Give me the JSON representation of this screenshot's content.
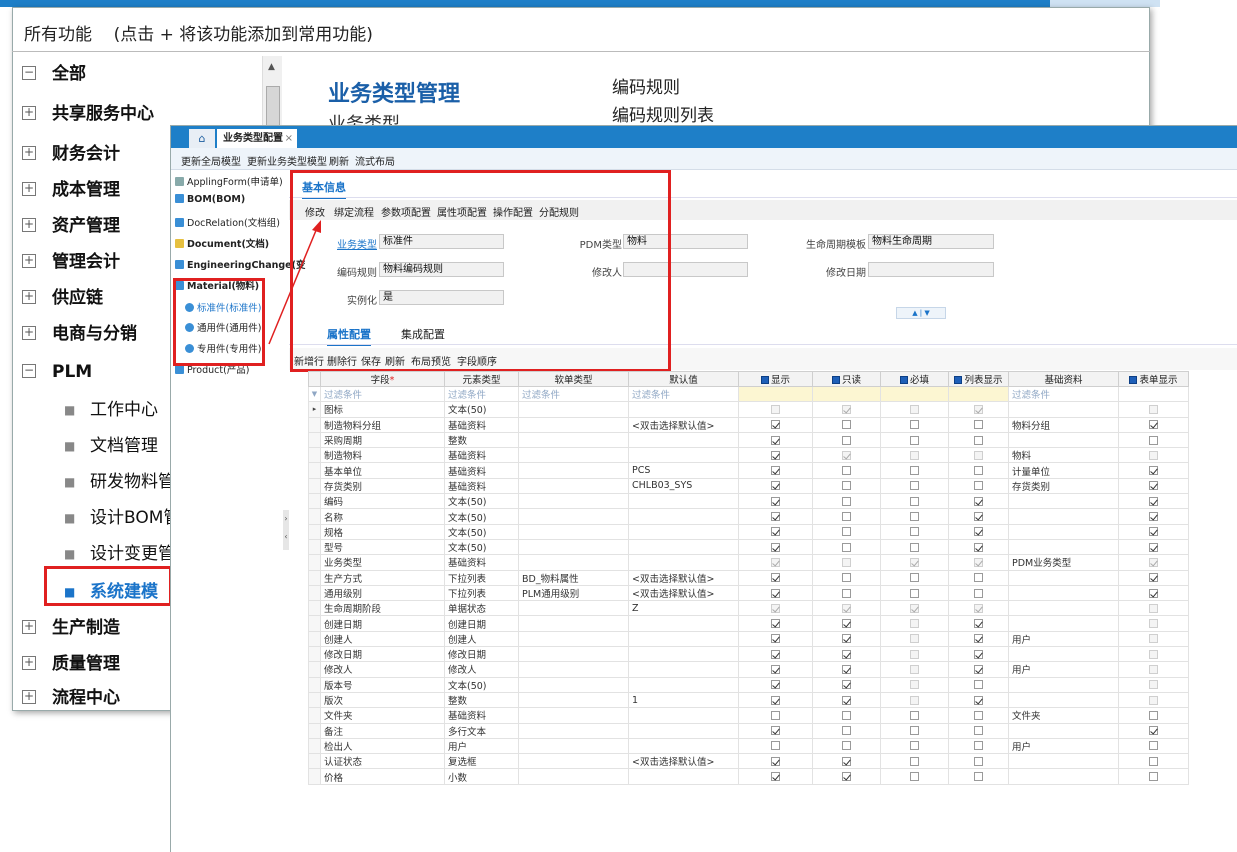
{
  "background_window": {
    "title": "所有功能    (点击 + 将该功能添加到常用功能)",
    "tree": [
      {
        "label": "全部",
        "box": "−",
        "type": "root"
      },
      {
        "label": "共享服务中心",
        "box": "+",
        "type": "node"
      },
      {
        "label": "财务会计",
        "box": "+",
        "type": "node"
      },
      {
        "label": "成本管理",
        "box": "+",
        "type": "node"
      },
      {
        "label": "资产管理",
        "box": "+",
        "type": "node"
      },
      {
        "label": "管理会计",
        "box": "+",
        "type": "node"
      },
      {
        "label": "供应链",
        "box": "+",
        "type": "node"
      },
      {
        "label": "电商与分销",
        "box": "+",
        "type": "node"
      },
      {
        "label": "PLM",
        "box": "−",
        "type": "node"
      },
      {
        "label": "工作中心",
        "type": "sub"
      },
      {
        "label": "文档管理",
        "type": "sub"
      },
      {
        "label": "研发物料管",
        "type": "sub"
      },
      {
        "label": "设计BOM管",
        "type": "sub"
      },
      {
        "label": "设计变更管",
        "type": "sub"
      },
      {
        "label": "系统建模",
        "type": "sub",
        "selected": true
      },
      {
        "label": "生产制造",
        "box": "+",
        "type": "node"
      },
      {
        "label": "质量管理",
        "box": "+",
        "type": "node"
      },
      {
        "label": "流程中心",
        "box": "+",
        "type": "node"
      }
    ],
    "right_title": "业务类型管理",
    "right_title2": "业务类型",
    "right_link1": "编码规则",
    "right_link2": "编码规则列表"
  },
  "front_window": {
    "home_icon": "home-icon",
    "active_tab": "业务类型配置",
    "close_glyph": "×",
    "toolbar": [
      "更新全局模型",
      "更新业务类型模型",
      "刷新",
      "流式布局"
    ],
    "left_nav": [
      {
        "label": "ApplingForm(申请单)",
        "icon": "form-icon",
        "bold": false
      },
      {
        "label": "BOM(BOM)",
        "icon": "bom-icon",
        "bold": true
      },
      {
        "label": "DocRelation(文档组)",
        "icon": "folder-icon",
        "bold": false
      },
      {
        "label": "Document(文档)",
        "icon": "document-icon",
        "bold": true
      },
      {
        "label": "EngineeringChange(变",
        "icon": "change-icon",
        "bold": true
      },
      {
        "label": "Material(物料)",
        "icon": "material-icon",
        "bold": true
      },
      {
        "label": "标准件(标准件)",
        "icon": "part-icon",
        "bold": false,
        "blue": true
      },
      {
        "label": "通用件(通用件)",
        "icon": "part-icon",
        "bold": false
      },
      {
        "label": "专用件(专用件)",
        "icon": "part-icon",
        "bold": false
      },
      {
        "label": "Product(产品)",
        "icon": "product-icon",
        "bold": false
      }
    ],
    "basic_tab": "基本信息",
    "action_bar": [
      "修改",
      "绑定流程",
      "参数项配置",
      "属性项配置",
      "操作配置",
      "分配规则"
    ],
    "form": {
      "biz_type_label": "业务类型",
      "biz_type_value": "标准件",
      "pdm_type_label": "PDM类型",
      "pdm_type_value": "物料",
      "lifecycle_label": "生命周期模板",
      "lifecycle_value": "物料生命周期",
      "code_rule_label": "编码规则",
      "code_rule_value": "物料编码规则",
      "modifier_label": "修改人",
      "modifier_value": "",
      "modify_date_label": "修改日期",
      "modify_date_value": "",
      "instantiate_label": "实例化",
      "instantiate_value": "是"
    },
    "collapse_glyph": "▲ | ▼",
    "sub_tabs": [
      "属性配置",
      "集成配置"
    ],
    "grid_toolbar": [
      "新增行",
      "删除行",
      "保存",
      "刷新",
      "布局预览",
      "字段顺序"
    ],
    "columns": [
      "字段",
      "元素类型",
      "软单类型",
      "默认值",
      "显示",
      "只读",
      "必填",
      "列表显示",
      "基础资料",
      "表单显示"
    ],
    "filter_text": "过滤条件",
    "rows": [
      {
        "f": "图标",
        "t": "文本(50)",
        "s": "",
        "d": "",
        "c": [
          0,
          1,
          0,
          1
        ],
        "b": "",
        "fm": 0,
        "dis": [
          1,
          1,
          1,
          1
        ],
        "fmdis": 1
      },
      {
        "f": "制造物料分组",
        "t": "基础资料",
        "s": "",
        "d": "<双击选择默认值>",
        "c": [
          1,
          0,
          0,
          0
        ],
        "b": "物料分组",
        "fm": 1
      },
      {
        "f": "采购周期",
        "t": "整数",
        "s": "",
        "d": "",
        "c": [
          1,
          0,
          0,
          0
        ],
        "b": "",
        "fm": 0
      },
      {
        "f": "制造物料",
        "t": "基础资料",
        "s": "",
        "d": "",
        "c": [
          1,
          1,
          0,
          0
        ],
        "b": "物料",
        "fm": 0,
        "dis": [
          0,
          1,
          1,
          1
        ],
        "fmdis": 1
      },
      {
        "f": "基本单位",
        "t": "基础资料",
        "s": "",
        "d": "PCS",
        "c": [
          1,
          0,
          0,
          0
        ],
        "b": "计量单位",
        "fm": 1
      },
      {
        "f": "存货类别",
        "t": "基础资料",
        "s": "",
        "d": "CHLB03_SYS",
        "c": [
          1,
          0,
          0,
          0
        ],
        "b": "存货类别",
        "fm": 1
      },
      {
        "f": "编码",
        "t": "文本(50)",
        "s": "",
        "d": "",
        "c": [
          1,
          0,
          0,
          1
        ],
        "b": "",
        "fm": 1
      },
      {
        "f": "名称",
        "t": "文本(50)",
        "s": "",
        "d": "",
        "c": [
          1,
          0,
          0,
          1
        ],
        "b": "",
        "fm": 1
      },
      {
        "f": "规格",
        "t": "文本(50)",
        "s": "",
        "d": "",
        "c": [
          1,
          0,
          0,
          1
        ],
        "b": "",
        "fm": 1
      },
      {
        "f": "型号",
        "t": "文本(50)",
        "s": "",
        "d": "",
        "c": [
          1,
          0,
          0,
          1
        ],
        "b": "",
        "fm": 1
      },
      {
        "f": "业务类型",
        "t": "基础资料",
        "s": "",
        "d": "",
        "c": [
          1,
          0,
          1,
          1
        ],
        "b": "PDM业务类型",
        "fm": 1,
        "dis": [
          1,
          1,
          1,
          1
        ],
        "fmdis": 1
      },
      {
        "f": "生产方式",
        "t": "下拉列表",
        "s": "BD_物料属性",
        "d": "<双击选择默认值>",
        "c": [
          1,
          0,
          0,
          0
        ],
        "b": "",
        "fm": 1
      },
      {
        "f": "通用级别",
        "t": "下拉列表",
        "s": "PLM通用级别",
        "d": "<双击选择默认值>",
        "c": [
          1,
          0,
          0,
          0
        ],
        "b": "",
        "fm": 1
      },
      {
        "f": "生命周期阶段",
        "t": "单据状态",
        "s": "",
        "d": "Z",
        "c": [
          1,
          1,
          1,
          1
        ],
        "b": "",
        "fm": 0,
        "dis": [
          1,
          1,
          1,
          1
        ],
        "fmdis": 1
      },
      {
        "f": "创建日期",
        "t": "创建日期",
        "s": "",
        "d": "",
        "c": [
          1,
          1,
          0,
          1
        ],
        "b": "",
        "fm": 0,
        "dis": [
          0,
          0,
          1,
          0
        ],
        "fmdis": 1
      },
      {
        "f": "创建人",
        "t": "创建人",
        "s": "",
        "d": "",
        "c": [
          1,
          1,
          0,
          1
        ],
        "b": "用户",
        "fm": 0,
        "dis": [
          0,
          0,
          1,
          0
        ],
        "fmdis": 1
      },
      {
        "f": "修改日期",
        "t": "修改日期",
        "s": "",
        "d": "",
        "c": [
          1,
          1,
          0,
          1
        ],
        "b": "",
        "fm": 0,
        "dis": [
          0,
          0,
          1,
          0
        ],
        "fmdis": 1
      },
      {
        "f": "修改人",
        "t": "修改人",
        "s": "",
        "d": "",
        "c": [
          1,
          1,
          0,
          1
        ],
        "b": "用户",
        "fm": 0,
        "dis": [
          0,
          0,
          1,
          0
        ],
        "fmdis": 1
      },
      {
        "f": "版本号",
        "t": "文本(50)",
        "s": "",
        "d": "",
        "c": [
          1,
          1,
          0,
          0
        ],
        "b": "",
        "fm": 0,
        "dis": [
          0,
          0,
          1,
          0
        ],
        "fmdis": 1
      },
      {
        "f": "版次",
        "t": "整数",
        "s": "",
        "d": "1",
        "c": [
          1,
          1,
          0,
          1
        ],
        "b": "",
        "fm": 0,
        "dis": [
          0,
          0,
          1,
          0
        ],
        "fmdis": 1
      },
      {
        "f": "文件夹",
        "t": "基础资料",
        "s": "",
        "d": "",
        "c": [
          0,
          0,
          0,
          0
        ],
        "b": "文件夹",
        "fm": 0
      },
      {
        "f": "备注",
        "t": "多行文本",
        "s": "",
        "d": "",
        "c": [
          1,
          0,
          0,
          0
        ],
        "b": "",
        "fm": 1
      },
      {
        "f": "检出人",
        "t": "用户",
        "s": "",
        "d": "",
        "c": [
          0,
          0,
          0,
          0
        ],
        "b": "用户",
        "fm": 0
      },
      {
        "f": "认证状态",
        "t": "复选框",
        "s": "",
        "d": "<双击选择默认值>",
        "c": [
          1,
          1,
          0,
          0
        ],
        "b": "",
        "fm": 0
      },
      {
        "f": "价格",
        "t": "小数",
        "s": "",
        "d": "",
        "c": [
          1,
          1,
          0,
          0
        ],
        "b": "",
        "fm": 0
      }
    ]
  }
}
